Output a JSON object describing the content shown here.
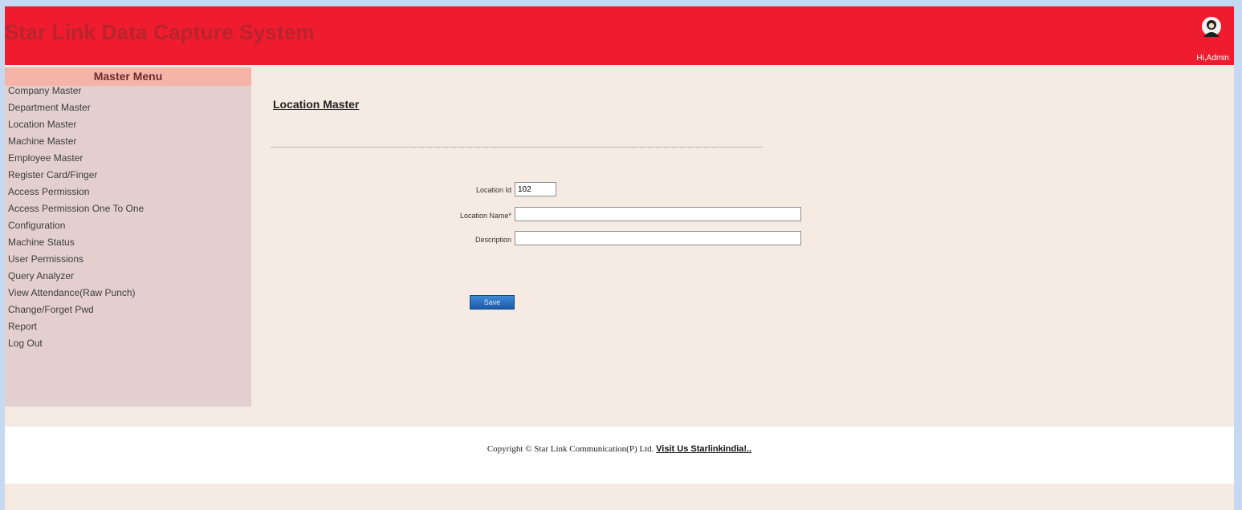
{
  "header": {
    "app_title": "Star Link Data Capture System",
    "greeting": "Hi,Admin"
  },
  "sidebar": {
    "heading": "Master Menu",
    "items": [
      "Company Master",
      "Department Master",
      "Location Master",
      "Machine Master",
      "Employee Master",
      "Register Card/Finger",
      "Access Permission",
      "Access Permission One To One",
      "Configuration",
      "Machine Status",
      "User Permissions",
      "Query Analyzer",
      "View Attendance(Raw Punch)",
      "Change/Forget Pwd",
      "Report",
      "Log Out"
    ]
  },
  "main": {
    "title": "Location Master",
    "form": {
      "location_id_label": "Location Id",
      "location_id_value": "102",
      "location_name_label": "Location Name*",
      "location_name_value": "",
      "description_label": "Description",
      "description_value": ""
    },
    "save_label": "Save"
  },
  "footer": {
    "copyright": "Copyright © Star Link Communication(P) Ltd.",
    "link_text": "Visit Us Starlinkindia!.."
  },
  "colors": {
    "header_bg": "#ee1c2e",
    "title_text": "#b8232e",
    "sidebar_bg": "#e4cfcf",
    "menu_heading_bg": "#f6b3a8",
    "content_bg": "#f5ebe3",
    "outer_bg": "#c5d9f1",
    "button": "#2a6fc2"
  },
  "icons": {
    "avatar": "user-avatar-icon"
  }
}
